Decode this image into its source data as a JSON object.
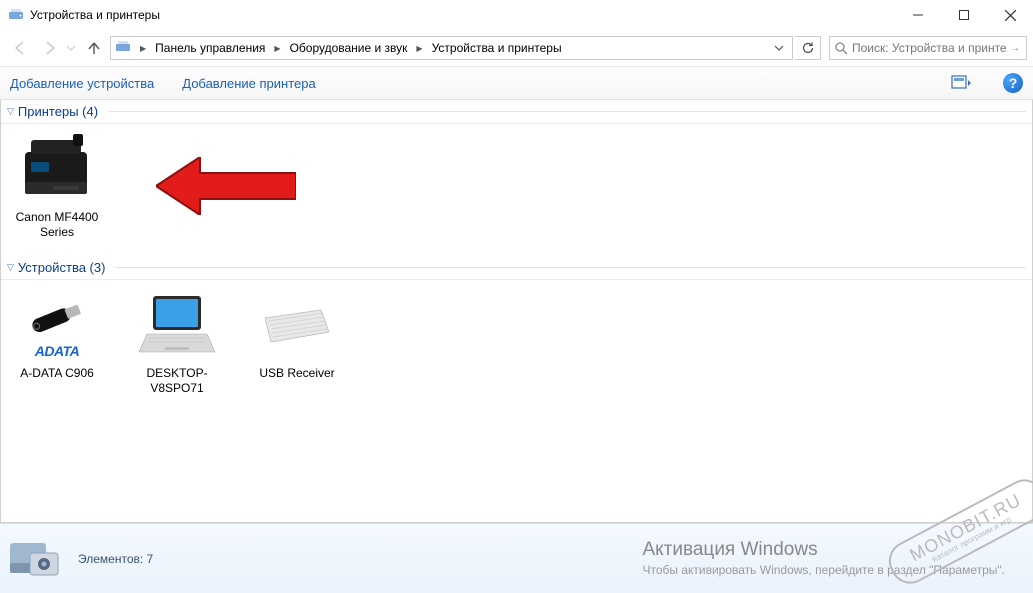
{
  "window": {
    "title": "Устройства и принтеры"
  },
  "breadcrumb": {
    "root": "Панель управления",
    "mid": "Оборудование и звук",
    "leaf": "Устройства и принтеры"
  },
  "search": {
    "placeholder": "Поиск: Устройства и принте..."
  },
  "commands": {
    "add_device": "Добавление устройства",
    "add_printer": "Добавление принтера"
  },
  "groups": {
    "printers": {
      "title": "Принтеры (4)",
      "items": [
        {
          "label": "Canon MF4400 Series"
        }
      ]
    },
    "devices": {
      "title": "Устройства (3)",
      "items": [
        {
          "label": "A-DATA C906"
        },
        {
          "label": "DESKTOP-V8SPO71"
        },
        {
          "label": "USB Receiver"
        }
      ]
    }
  },
  "status": {
    "elements_label": "Элементов: 7"
  },
  "activation": {
    "title": "Активация Windows",
    "line": "Чтобы активировать Windows, перейдите в раздел \"Параметры\"."
  },
  "stamp": {
    "big": "MONOBIT.RU",
    "small": "Каталог программ и игр"
  }
}
